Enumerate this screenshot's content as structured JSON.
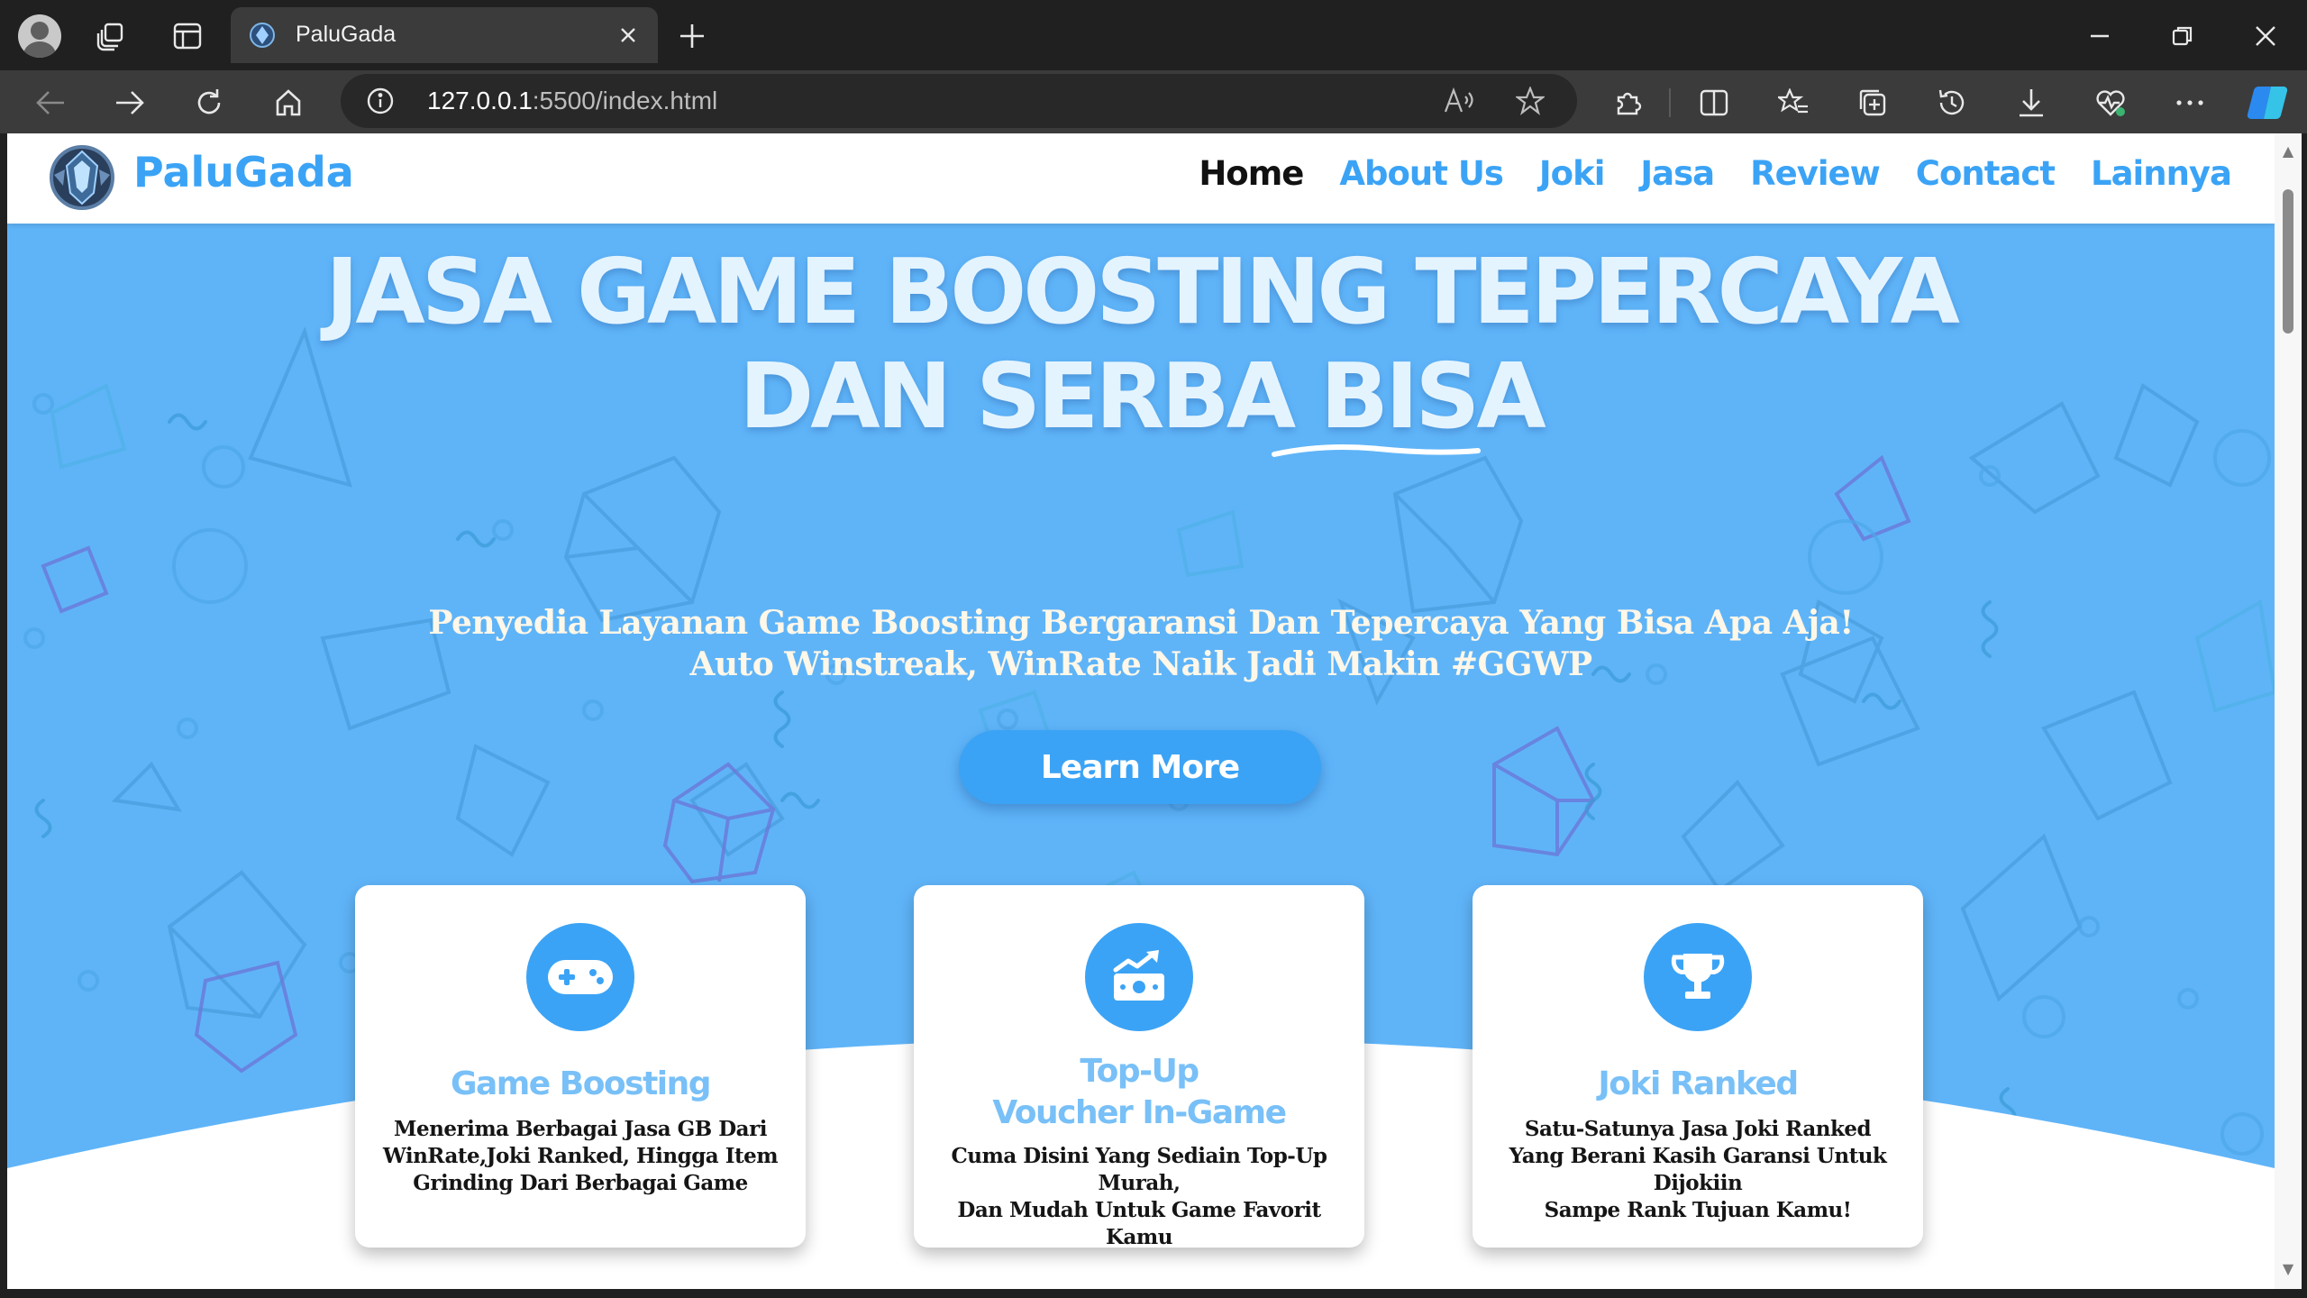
{
  "browser": {
    "tab_title": "PaluGada",
    "url_host": "127.0.0.1",
    "url_rest": ":5500/index.html"
  },
  "site": {
    "brand": "PaluGada",
    "nav": [
      {
        "label": "Home",
        "active": true
      },
      {
        "label": "About Us",
        "active": false
      },
      {
        "label": "Joki",
        "active": false
      },
      {
        "label": "Jasa",
        "active": false
      },
      {
        "label": "Review",
        "active": false
      },
      {
        "label": "Contact",
        "active": false
      },
      {
        "label": "Lainnya",
        "active": false
      }
    ]
  },
  "hero": {
    "title_line1": "JASA GAME BOOSTING TEPERCAYA",
    "title_line2_a": "DAN SERBA ",
    "title_line2_b": "BISA",
    "subtitle_line1": "Penyedia Layanan Game Boosting Bergaransi Dan Tepercaya Yang Bisa Apa Aja!",
    "subtitle_line2": "Auto Winstreak, WinRate Naik Jadi Makin #GGWP",
    "cta": "Learn More"
  },
  "cards": [
    {
      "icon": "gamepad-icon",
      "title": [
        "Game Boosting"
      ],
      "desc": [
        "Menerima Berbagai Jasa GB Dari",
        "WinRate,Joki Ranked, Hingga Item",
        "Grinding Dari Berbagai Game"
      ]
    },
    {
      "icon": "money-growth-icon",
      "title": [
        "Top-Up",
        "Voucher In-Game"
      ],
      "desc": [
        "Cuma Disini Yang Sediain Top-Up Murah,",
        "Dan Mudah Untuk Game Favorit Kamu"
      ]
    },
    {
      "icon": "trophy-icon",
      "title": [
        "Joki Ranked"
      ],
      "desc": [
        "Satu-Satunya Jasa Joki Ranked",
        "Yang Berani Kasih Garansi Untuk Dijokiin",
        "Sampe Rank Tujuan Kamu!"
      ]
    }
  ],
  "colors": {
    "accent": "#3ba3f5",
    "hero_bg": "#5fb4f8",
    "title_text": "#e4f4ff",
    "card_title": "#78c0f7"
  }
}
